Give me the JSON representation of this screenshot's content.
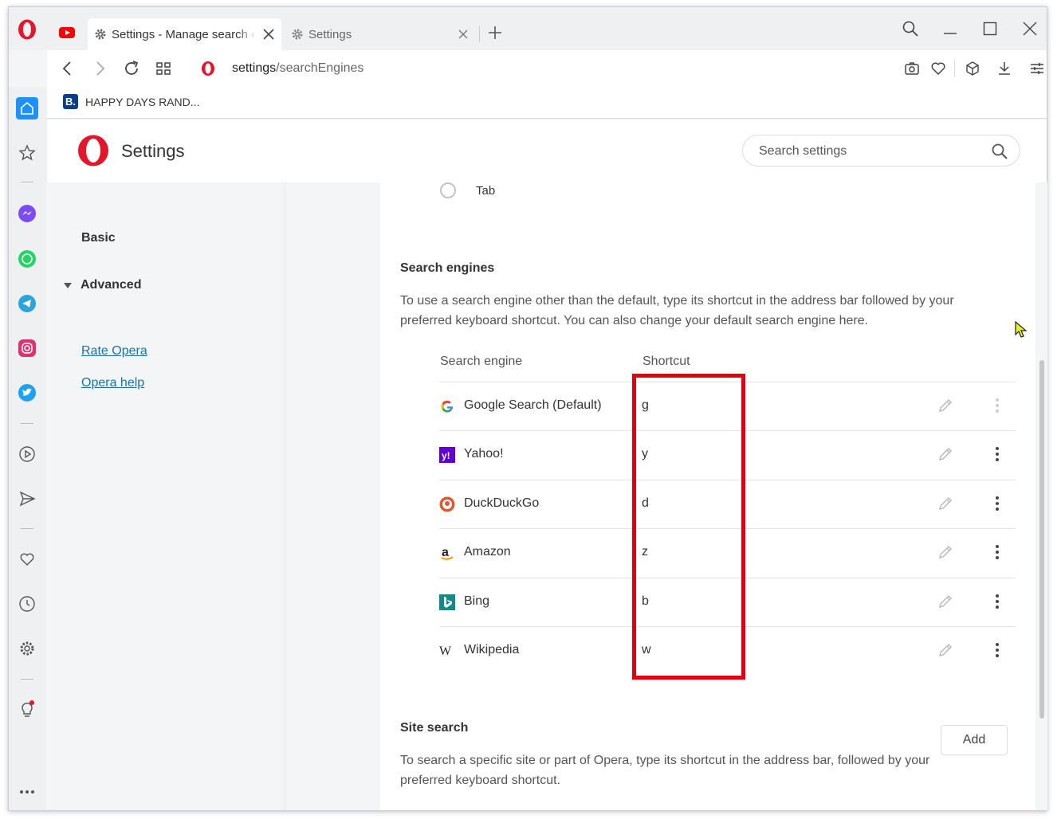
{
  "browser": {
    "active_tab": {
      "title": "Settings - Manage search engines"
    },
    "inactive_tab": {
      "title": "Settings"
    },
    "address": {
      "host": "settings",
      "path": "/searchEngines"
    },
    "bookmark": {
      "label": "HAPPY DAYS RAND...",
      "icon_letter": "B."
    }
  },
  "sidebar": {
    "items": [
      "home-icon",
      "star-icon",
      "messenger-icon",
      "whatsapp-icon",
      "telegram-icon",
      "instagram-icon",
      "twitter-icon",
      "player-icon",
      "send-icon",
      "heart-icon",
      "history-icon",
      "settings-icon",
      "tips-icon",
      "more-icon"
    ]
  },
  "settings": {
    "title": "Settings",
    "search_placeholder": "Search settings",
    "nav": {
      "basic": "Basic",
      "advanced": "Advanced",
      "rate": "Rate Opera",
      "help": "Opera help"
    },
    "radio_option": "Tab",
    "search_engines": {
      "title": "Search engines",
      "description": "To use a search engine other than the default, type its shortcut in the address bar followed by your preferred keyboard shortcut. You can also change your default search engine here.",
      "col_engine": "Search engine",
      "col_shortcut": "Shortcut",
      "rows": [
        {
          "name": "Google Search (Default)",
          "keyword": "g",
          "icon": "google-icon"
        },
        {
          "name": "Yahoo!",
          "keyword": "y",
          "icon": "yahoo-icon"
        },
        {
          "name": "DuckDuckGo",
          "keyword": "d",
          "icon": "duckduckgo-icon"
        },
        {
          "name": "Amazon",
          "keyword": "z",
          "icon": "amazon-icon"
        },
        {
          "name": "Bing",
          "keyword": "b",
          "icon": "bing-icon"
        },
        {
          "name": "Wikipedia",
          "keyword": "w",
          "icon": "wikipedia-icon"
        }
      ]
    },
    "site_search": {
      "title": "Site search",
      "description": "To search a specific site or part of Opera, type its shortcut in the address bar, followed by your preferred keyboard shortcut.",
      "add_label": "Add"
    }
  },
  "colors": {
    "highlight": "#e00012",
    "opera_red": "#e3162b",
    "link": "#1a73a8"
  }
}
